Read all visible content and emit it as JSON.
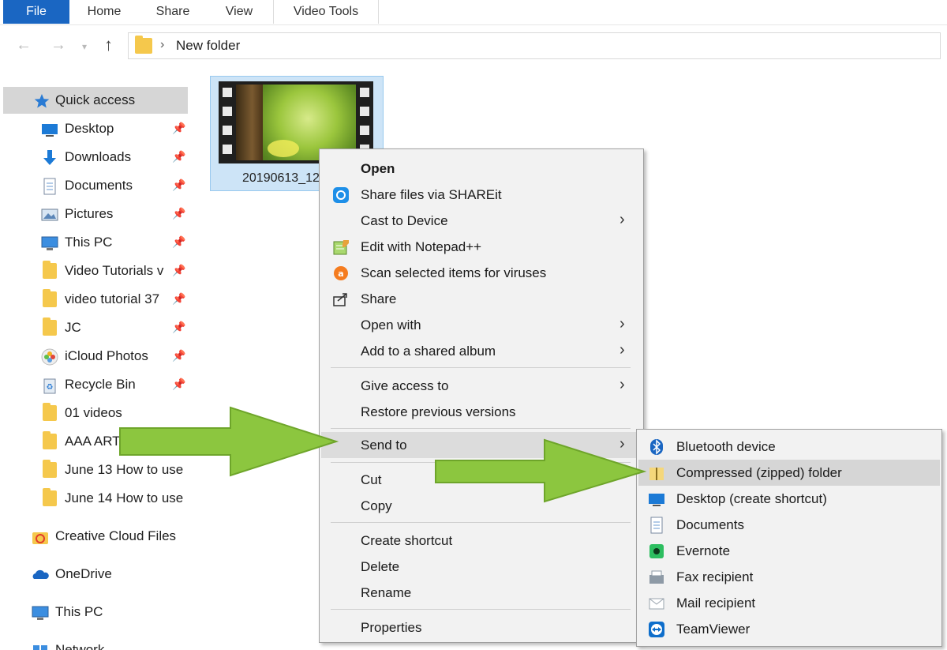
{
  "ribbon": {
    "tabs": [
      "File",
      "Home",
      "Share",
      "View",
      "Video Tools"
    ]
  },
  "address": {
    "path": "New folder"
  },
  "sidebar": {
    "quick_access": "Quick access",
    "items": [
      {
        "label": "Desktop",
        "icon": "desktop-icon"
      },
      {
        "label": "Downloads",
        "icon": "download-icon"
      },
      {
        "label": "Documents",
        "icon": "documents-icon"
      },
      {
        "label": "Pictures",
        "icon": "pictures-icon"
      },
      {
        "label": "This PC",
        "icon": "monitor-icon"
      },
      {
        "label": "Video Tutorials v",
        "icon": "folder-icon"
      },
      {
        "label": "video tutorial 37",
        "icon": "folder-icon"
      },
      {
        "label": "JC",
        "icon": "folder-icon"
      },
      {
        "label": "iCloud Photos",
        "icon": "icloud-photos-icon"
      },
      {
        "label": "Recycle Bin",
        "icon": "recycle-bin-icon"
      },
      {
        "label": "01 videos",
        "icon": "folder-icon"
      },
      {
        "label": "AAA ART",
        "icon": "folder-icon"
      },
      {
        "label": "June 13 How to use",
        "icon": "folder-icon"
      },
      {
        "label": "June 14 How to use",
        "icon": "folder-icon"
      }
    ],
    "creative_cloud": "Creative Cloud Files",
    "onedrive": "OneDrive",
    "this_pc": "This PC",
    "network": "Network"
  },
  "file": {
    "name": "20190613_12"
  },
  "context_menu": {
    "items": [
      {
        "label": "Open"
      },
      {
        "label": "Share files via SHAREit"
      },
      {
        "label": "Cast to Device"
      },
      {
        "label": "Edit with Notepad++"
      },
      {
        "label": "Scan selected items for viruses"
      },
      {
        "label": "Share"
      },
      {
        "label": "Open with"
      },
      {
        "label": "Add to a shared album"
      },
      {
        "label": "Give access to"
      },
      {
        "label": "Restore previous versions"
      },
      {
        "label": "Send to"
      },
      {
        "label": "Cut"
      },
      {
        "label": "Copy"
      },
      {
        "label": "Create shortcut"
      },
      {
        "label": "Delete"
      },
      {
        "label": "Rename"
      },
      {
        "label": "Properties"
      }
    ]
  },
  "send_to_menu": {
    "items": [
      {
        "label": "Bluetooth device",
        "icon": "bluetooth-icon"
      },
      {
        "label": "Compressed (zipped) folder",
        "icon": "zip-folder-icon"
      },
      {
        "label": "Desktop (create shortcut)",
        "icon": "desktop-icon"
      },
      {
        "label": "Documents",
        "icon": "documents-icon"
      },
      {
        "label": "Evernote",
        "icon": "evernote-icon"
      },
      {
        "label": "Fax recipient",
        "icon": "fax-icon"
      },
      {
        "label": "Mail recipient",
        "icon": "mail-icon"
      },
      {
        "label": "TeamViewer",
        "icon": "teamviewer-icon"
      }
    ]
  },
  "colors": {
    "accent": "#1a66c2",
    "arrow": "#8cc63f",
    "selection": "#cde4f7",
    "menu_bg": "#f2f2f2"
  }
}
